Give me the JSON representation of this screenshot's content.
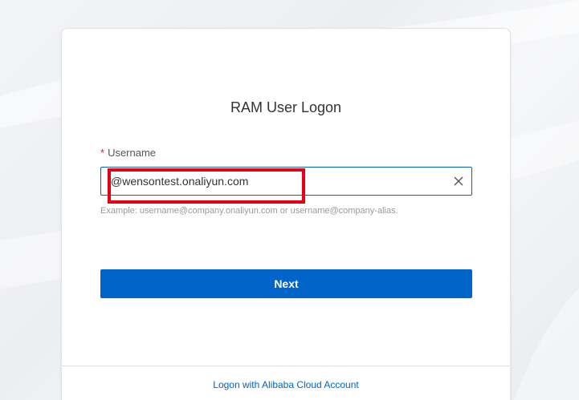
{
  "login": {
    "title": "RAM User Logon",
    "username_required_mark": "*",
    "username_label": "Username",
    "username_value": "@wensontest.onaliyun.com",
    "username_hint": "Example: username@company.onaliyun.com or username@company-alias.",
    "next_label": "Next",
    "alt_logon_link": "Logon with Alibaba Cloud Account"
  },
  "colors": {
    "primary": "#0064c8",
    "required": "#e02020",
    "highlight": "#e60012"
  },
  "icons": {
    "clear": "close-icon"
  }
}
